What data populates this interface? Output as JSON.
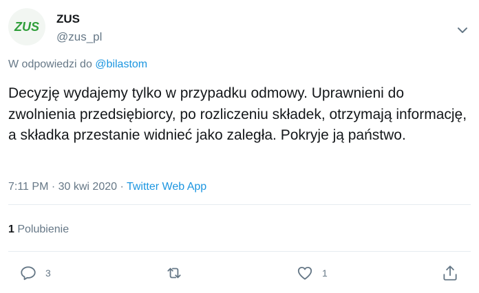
{
  "author": {
    "avatar_text": "ZUS",
    "name": "ZUS",
    "handle": "@zus_pl"
  },
  "reply": {
    "prefix": "W odpowiedzi do",
    "mention": "@bilastom"
  },
  "tweet": {
    "text": "Decyzję wydajemy tylko w przypadku odmowy. Uprawnieni do zwolnienia przedsiębiorcy, po rozliczeniu składek, otrzymają informację, a składka przestanie widnieć jako zaległa. Pokryje ją państwo."
  },
  "meta": {
    "time": "7:11 PM",
    "sep1": " · ",
    "date": "30 kwi 2020",
    "sep2": " · ",
    "source": "Twitter Web App"
  },
  "likes": {
    "count": "1",
    "label": "Polubienie"
  },
  "actions": {
    "reply_count": "3",
    "like_count": "1"
  },
  "colors": {
    "brand_green": "#2f9e3a",
    "link": "#1b95e0",
    "muted": "#657786"
  },
  "icons": [
    "chevron-down-icon",
    "reply-icon",
    "retweet-icon",
    "heart-icon",
    "share-icon"
  ]
}
